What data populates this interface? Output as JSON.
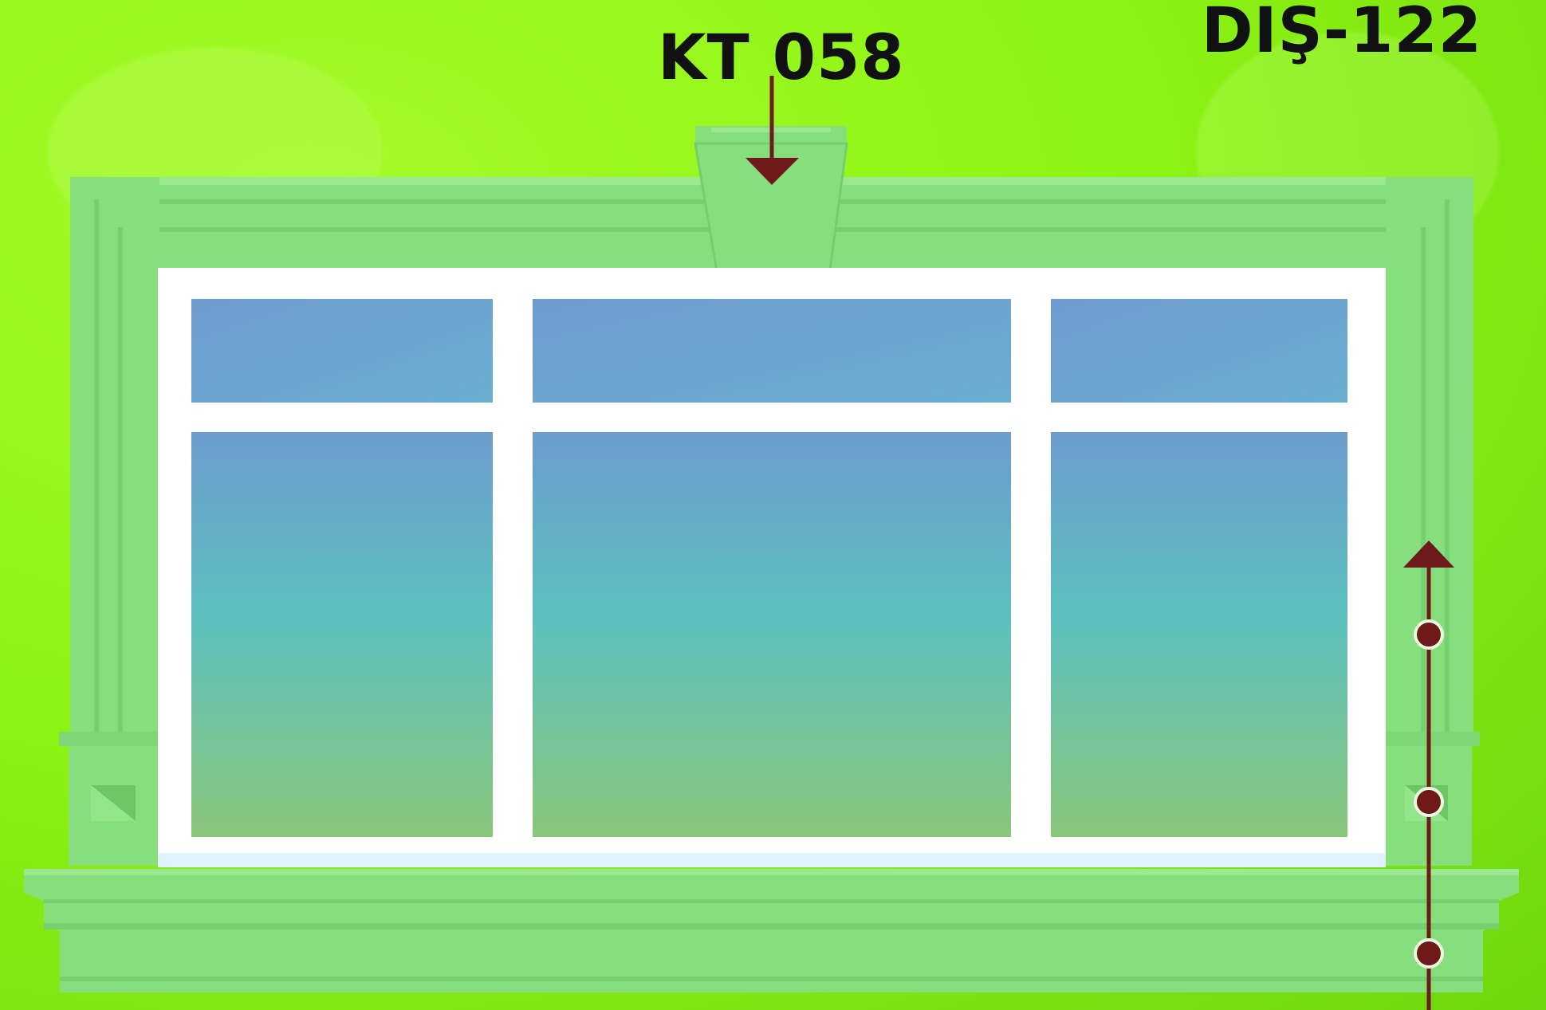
{
  "labels": {
    "keystone_code": "KT 058",
    "profile_code": "DIŞ-122"
  },
  "colors": {
    "background": "#8ef414",
    "molding": "#86de7c",
    "molding_shadow": "#6cc665",
    "frame": "#ffffff",
    "glass_top": "#6d9ccd",
    "glass_bottom": "#8cc87a",
    "marker": "#6e1a1a"
  },
  "icons": {
    "keystone_arrow": "arrow-down-icon",
    "profile_arrow": "arrow-up-icon",
    "profile_points": "dot-marker-icon"
  }
}
